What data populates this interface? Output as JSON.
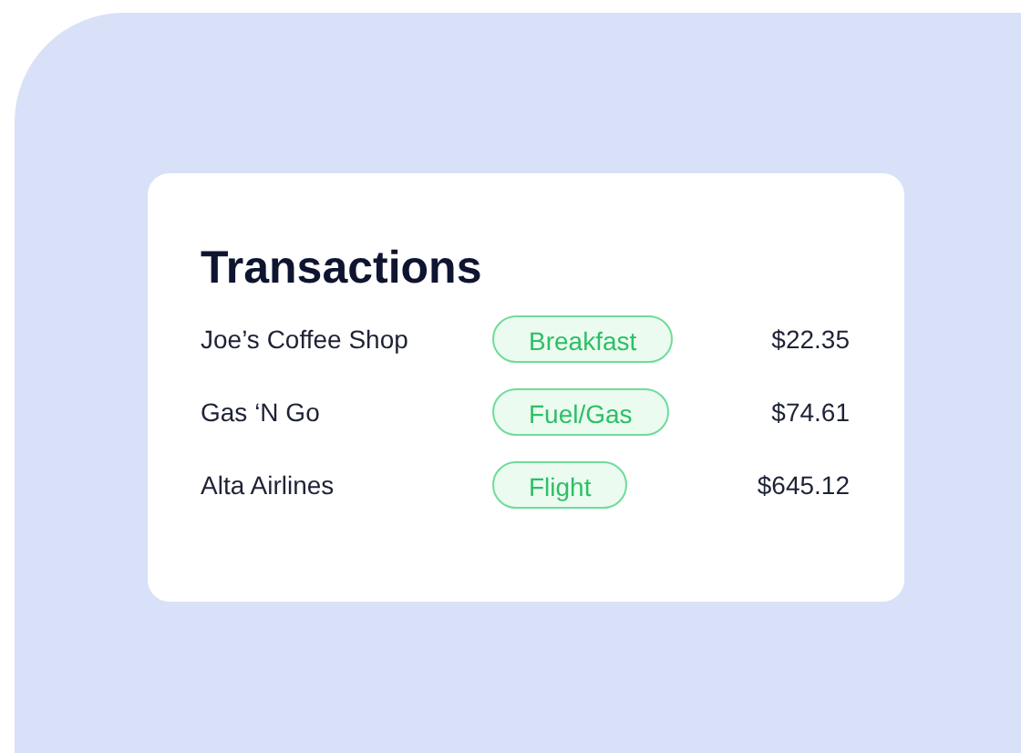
{
  "card": {
    "title": "Transactions",
    "rows": [
      {
        "merchant": "Joe’s Coffee Shop",
        "category": "Breakfast",
        "amount": "$22.35"
      },
      {
        "merchant": "Gas ‘N Go",
        "category": "Fuel/Gas",
        "amount": "$74.61"
      },
      {
        "merchant": "Alta Airlines",
        "category": "Flight",
        "amount": "$645.12"
      }
    ]
  }
}
